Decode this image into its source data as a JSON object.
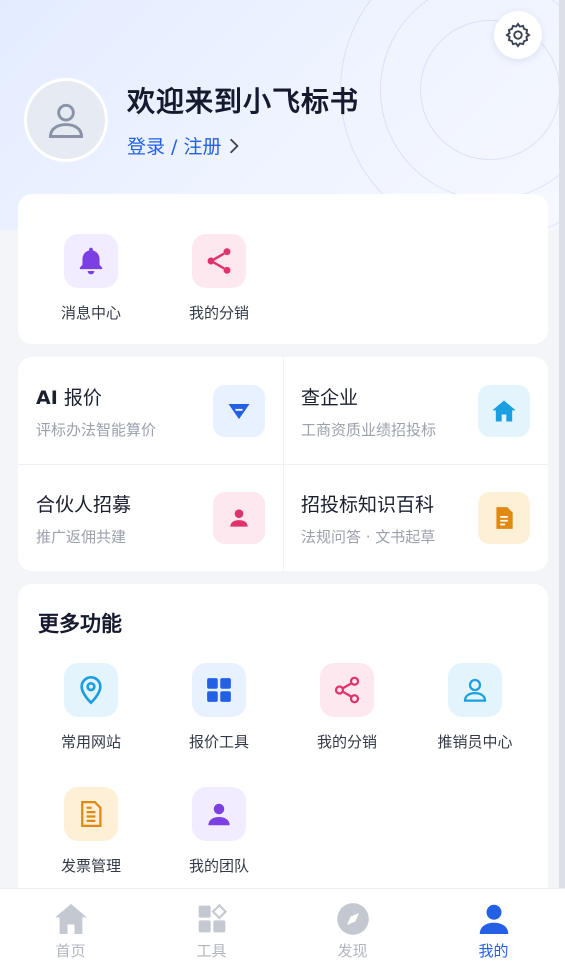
{
  "header": {
    "welcome": "欢迎来到小飞标书",
    "login_label": "登录 / 注册"
  },
  "quick_actions": [
    {
      "label": "消息中心",
      "icon": "bell-icon"
    },
    {
      "label": "我的分销",
      "icon": "share-icon"
    }
  ],
  "services": [
    {
      "title_prefix": "AI",
      "title": " 报价",
      "subtitle": "评标办法智能算价",
      "icon": "gem-icon"
    },
    {
      "title_prefix": "",
      "title": "查企业",
      "subtitle": "工商资质业绩招投标",
      "icon": "home-icon"
    },
    {
      "title_prefix": "",
      "title": "合伙人招募",
      "subtitle": "推广返佣共建",
      "icon": "person-icon"
    },
    {
      "title_prefix": "",
      "title": "招投标知识百科",
      "subtitle": "法规问答 · 文书起草",
      "icon": "document-icon"
    }
  ],
  "more": {
    "title": "更多功能",
    "items": [
      {
        "label": "常用网站",
        "icon": "location-pin-icon"
      },
      {
        "label": "报价工具",
        "icon": "grid-icon"
      },
      {
        "label": "我的分销",
        "icon": "share-icon"
      },
      {
        "label": "推销员中心",
        "icon": "user-outline-icon"
      },
      {
        "label": "发票管理",
        "icon": "invoice-icon"
      },
      {
        "label": "我的团队",
        "icon": "team-icon"
      }
    ]
  },
  "tabs": [
    {
      "label": "首页",
      "icon": "home-icon"
    },
    {
      "label": "工具",
      "icon": "tools-icon"
    },
    {
      "label": "发现",
      "icon": "compass-icon"
    },
    {
      "label": "我的",
      "icon": "profile-icon",
      "active": true
    }
  ],
  "colors": {
    "accent": "#2460e6",
    "purple": "#7b3fe4",
    "pink": "#e0336e",
    "cyan": "#1a9fe0",
    "orange": "#e08a12"
  }
}
